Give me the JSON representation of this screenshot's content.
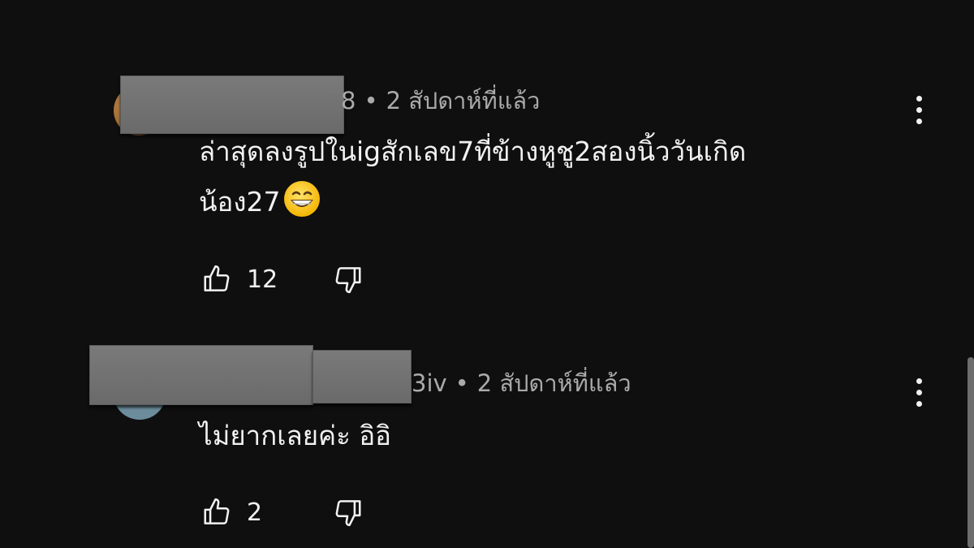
{
  "comments": [
    {
      "author_suffix": "8",
      "separator": "•",
      "time": "2 สัปดาห์ที่แล้ว",
      "text_line1": "ล่าสุดลงรูปในigสักเลข7ที่ข้างหูชู2สองนิ้ววันเกิด",
      "text_line2": "น้อง27",
      "emoji_icon": "grinning-face-with-smiling-eyes",
      "likes": "12"
    },
    {
      "author_suffix": "3iv",
      "separator": "•",
      "time": "2 สัปดาห์ที่แล้ว",
      "text_line1": "ไม่ยากเลยค่ะ อิอิ",
      "likes": "2"
    }
  ],
  "icons": {
    "like": "thumbs-up-icon",
    "dislike": "thumbs-down-icon",
    "more": "more-vert-icon"
  },
  "colors": {
    "background": "#0f0f0f",
    "text": "#f1f1f1",
    "meta": "#aaaaaa",
    "redaction": "#737373"
  }
}
